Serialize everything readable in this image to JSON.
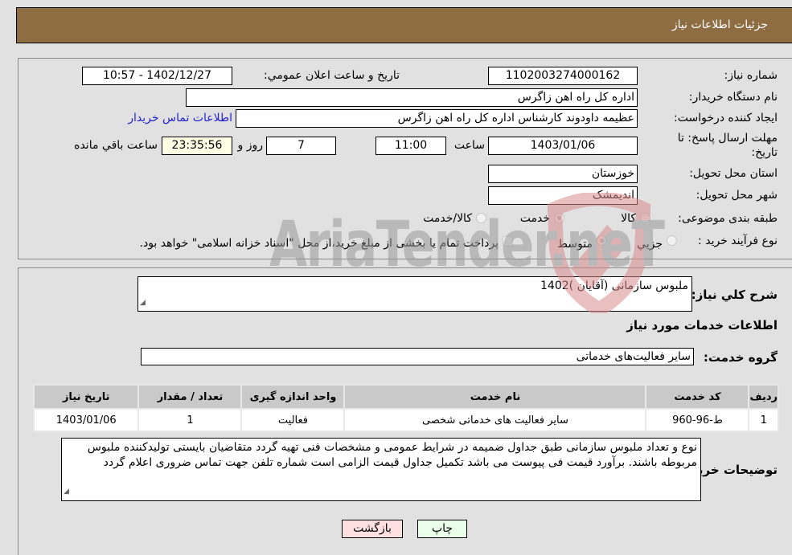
{
  "header": {
    "title": "جزئیات اطلاعات نیاز"
  },
  "fields": {
    "need_number": {
      "label": "شماره نیاز:",
      "value": "1102003274000162"
    },
    "announce_datetime": {
      "label": "تاریخ و ساعت اعلان عمومي:",
      "value": "1402/12/27 - 10:57"
    },
    "buyer_org": {
      "label": "نام دستگاه خریدار:",
      "value": "اداره کل راه اهن زاگرس"
    },
    "requester": {
      "label": "ایجاد کننده درخواست:",
      "value": "عظیمه  داودوند کارشناس اداره کل راه اهن زاگرس"
    },
    "buyer_contact_link": "اطلاعات تماس خریدار",
    "deadline": {
      "label": "مهلت ارسال پاسخ: تا تاریخ:",
      "date": "1403/01/06",
      "time_label": "ساعت",
      "time": "11:00",
      "days": "7",
      "days_label": "روز و",
      "remaining": "23:35:56",
      "remaining_label": "ساعت باقي مانده"
    },
    "province": {
      "label": "استان محل تحویل:",
      "value": "خوزستان"
    },
    "city": {
      "label": "شهر محل تحویل:",
      "value": "اندیمشک"
    },
    "category": {
      "label": "طبقه بندی موضوعی:",
      "options": [
        "کالا",
        "خدمت",
        "کالا/خدمت"
      ],
      "selected": "خدمت"
    },
    "process_type": {
      "label": "نوع فرآیند خرید :",
      "options": [
        "جزيي",
        "متوسط"
      ],
      "selected": "متوسط",
      "treasury_note": "پرداخت تمام یا بخشی از مبلغ خرید،از محل \"اسناد خزانه اسلامی\" خواهد بود."
    }
  },
  "summary": {
    "label": "شرح كلي نياز:",
    "value": "ملبوس سازمانی (آقایان )1402"
  },
  "services_section": {
    "title": "اطلاعات خدمات مورد نياز"
  },
  "service_group": {
    "label": "گروه خدمت:",
    "value": "سایر فعالیت‌های خدماتی"
  },
  "table": {
    "headers": [
      "ردیف",
      "کد خدمت",
      "نام خدمت",
      "واحد اندازه گیری",
      "تعداد / مقدار",
      "تاریخ نیاز"
    ],
    "rows": [
      [
        "1",
        "ط-96-960",
        "سایر فعالیت های خدماتی شخصی",
        "فعالیت",
        "1",
        "1403/01/06"
      ]
    ]
  },
  "buyer_notes": {
    "label": "توضیحات خریدار:",
    "value": "نوع و تعداد ملبوس سازمانی طبق جداول ضمیمه در شرایط عمومی و مشخصات فنی تهیه گردد متقاضیان بایستی تولیدکننده ملبوس مربوطه باشند. برآورد قیمت فی پیوست می باشد تکمیل جداول قیمت الزامی است شماره تلفن جهت تماس ضروری اعلام گردد"
  },
  "buttons": {
    "print": "چاپ",
    "back": "بازگشت"
  },
  "watermark": "AriaTender.neT",
  "colors": {
    "header_bg": "#8e6d42",
    "link": "#2222cc",
    "print_bg": "#eaffea",
    "back_bg": "#ffe0e0",
    "remaining_bg": "#ffffe6"
  }
}
